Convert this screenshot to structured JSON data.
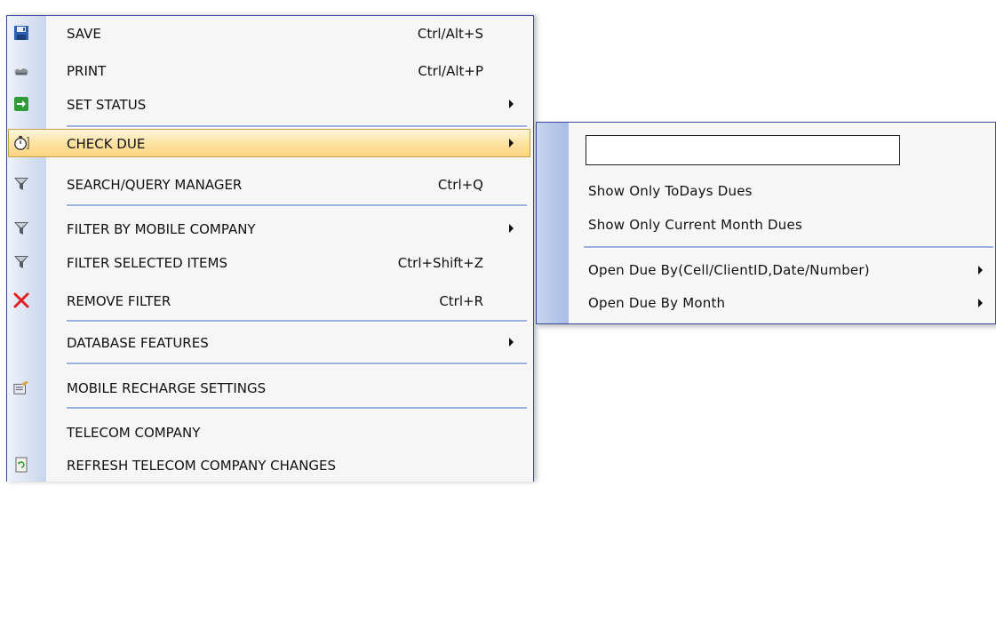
{
  "main_menu": {
    "items": [
      {
        "label": "SAVE",
        "shortcut": "Ctrl/Alt+S",
        "icon": "save-icon"
      },
      {
        "label": "PRINT",
        "shortcut": "Ctrl/Alt+P",
        "icon": "print-icon"
      },
      {
        "label": "SET STATUS",
        "shortcut": "",
        "icon": "green-arrow-icon",
        "submenu": true
      },
      {
        "label": "CHECK DUE",
        "shortcut": "",
        "icon": "stopwatch-icon",
        "submenu": true,
        "highlighted": true
      },
      {
        "label": "SEARCH/QUERY MANAGER",
        "shortcut": "Ctrl+Q",
        "icon": "funnel-icon"
      },
      {
        "label": "FILTER BY MOBILE COMPANY",
        "shortcut": "",
        "icon": "funnel-icon",
        "submenu": true
      },
      {
        "label": "FILTER SELECTED ITEMS",
        "shortcut": "Ctrl+Shift+Z",
        "icon": "funnel-icon"
      },
      {
        "label": "REMOVE FILTER",
        "shortcut": "Ctrl+R",
        "icon": "red-x-icon"
      },
      {
        "label": "DATABASE FEATURES",
        "shortcut": "",
        "icon": "",
        "submenu": true
      },
      {
        "label": "MOBILE RECHARGE SETTINGS",
        "shortcut": "",
        "icon": "settings-card-icon"
      },
      {
        "label": "TELECOM COMPANY",
        "shortcut": "",
        "icon": ""
      },
      {
        "label": "REFRESH TELECOM COMPANY CHANGES",
        "shortcut": "",
        "icon": "refresh-icon"
      }
    ]
  },
  "check_due_menu": {
    "input_value": "",
    "items": [
      {
        "label": "Show Only ToDays Dues",
        "submenu": false
      },
      {
        "label": "Show Only Current Month Dues",
        "submenu": false
      },
      {
        "label": "Open Due By(Cell/ClientID,Date/Number)",
        "submenu": true
      },
      {
        "label": "Open Due By Month",
        "submenu": true
      }
    ]
  },
  "colors": {
    "menu_border": "#3b4b9a",
    "highlight": "#fbd47e",
    "separator": "#9ab0dd",
    "gutter": "#c9d6ee"
  }
}
